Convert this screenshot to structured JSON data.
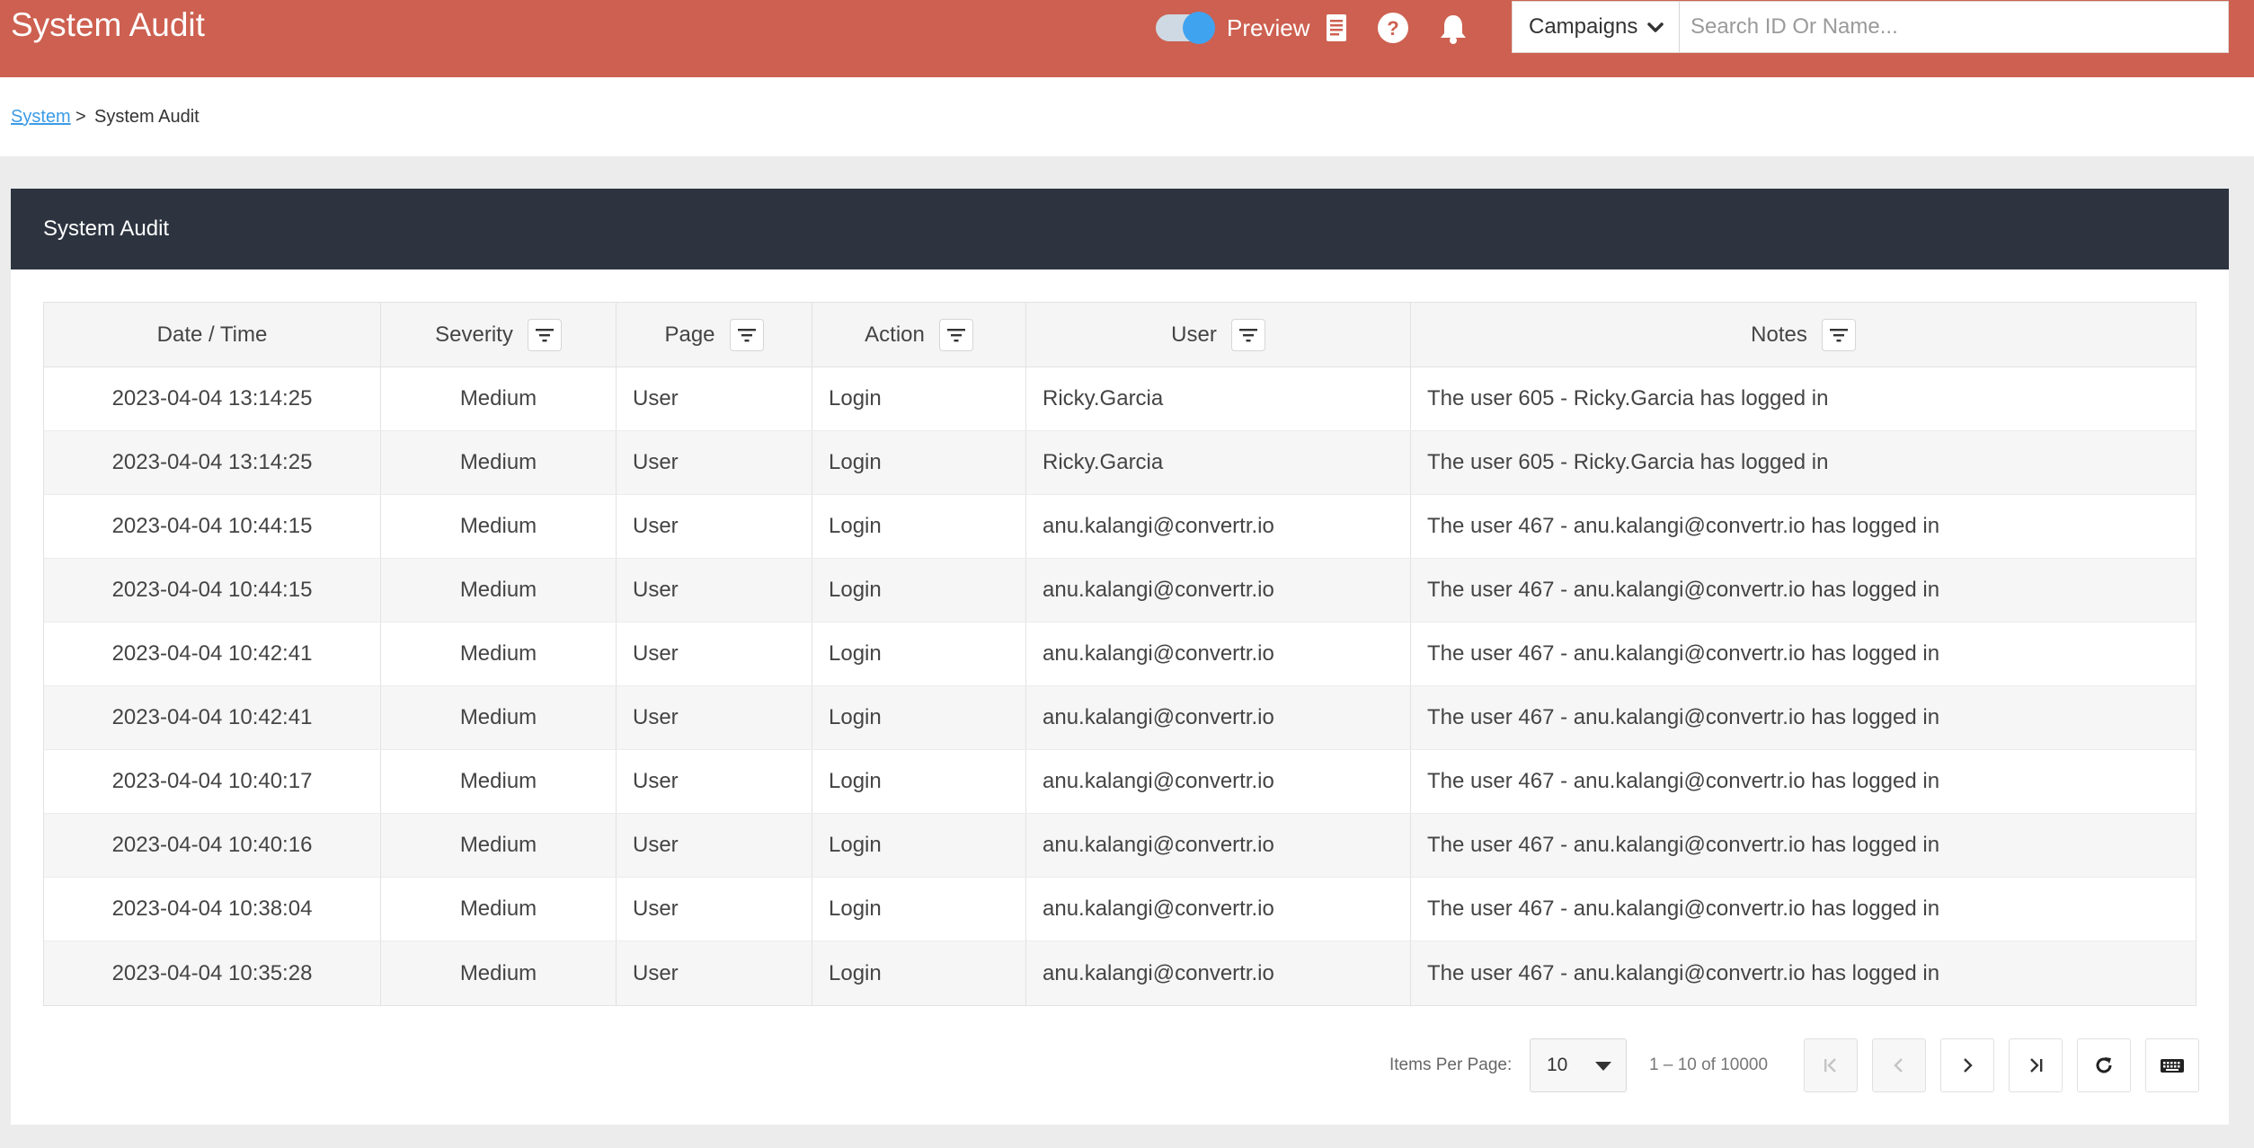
{
  "header": {
    "title": "System Audit",
    "preview_label": "Preview",
    "campaigns_label": "Campaigns",
    "search_placeholder": "Search ID Or Name..."
  },
  "breadcrumb": {
    "root": "System",
    "separator": ">",
    "current": "System Audit"
  },
  "card": {
    "title": "System Audit"
  },
  "table": {
    "columns": [
      "Date / Time",
      "Severity",
      "Page",
      "Action",
      "User",
      "Notes"
    ],
    "rows": [
      [
        "2023-04-04 13:14:25",
        "Medium",
        "User",
        "Login",
        "Ricky.Garcia",
        "The user 605 - Ricky.Garcia has logged in"
      ],
      [
        "2023-04-04 13:14:25",
        "Medium",
        "User",
        "Login",
        "Ricky.Garcia",
        "The user 605 - Ricky.Garcia has logged in"
      ],
      [
        "2023-04-04 10:44:15",
        "Medium",
        "User",
        "Login",
        "anu.kalangi@convertr.io",
        "The user 467 - anu.kalangi@convertr.io has logged in"
      ],
      [
        "2023-04-04 10:44:15",
        "Medium",
        "User",
        "Login",
        "anu.kalangi@convertr.io",
        "The user 467 - anu.kalangi@convertr.io has logged in"
      ],
      [
        "2023-04-04 10:42:41",
        "Medium",
        "User",
        "Login",
        "anu.kalangi@convertr.io",
        "The user 467 - anu.kalangi@convertr.io has logged in"
      ],
      [
        "2023-04-04 10:42:41",
        "Medium",
        "User",
        "Login",
        "anu.kalangi@convertr.io",
        "The user 467 - anu.kalangi@convertr.io has logged in"
      ],
      [
        "2023-04-04 10:40:17",
        "Medium",
        "User",
        "Login",
        "anu.kalangi@convertr.io",
        "The user 467 - anu.kalangi@convertr.io has logged in"
      ],
      [
        "2023-04-04 10:40:16",
        "Medium",
        "User",
        "Login",
        "anu.kalangi@convertr.io",
        "The user 467 - anu.kalangi@convertr.io has logged in"
      ],
      [
        "2023-04-04 10:38:04",
        "Medium",
        "User",
        "Login",
        "anu.kalangi@convertr.io",
        "The user 467 - anu.kalangi@convertr.io has logged in"
      ],
      [
        "2023-04-04 10:35:28",
        "Medium",
        "User",
        "Login",
        "anu.kalangi@convertr.io",
        "The user 467 - anu.kalangi@convertr.io has logged in"
      ]
    ]
  },
  "pagination": {
    "items_per_page_label": "Items Per Page:",
    "items_per_page_value": "10",
    "range": "1 – 10 of 10000"
  },
  "colors": {
    "header_bg": "#cd6050",
    "card_header_bg": "#2d3440",
    "toggle_knob": "#3fa3f0",
    "link": "#3b9be6"
  },
  "icons": {
    "header": [
      "document-icon",
      "help-icon",
      "bell-icon"
    ],
    "filter": "filter-icon",
    "pagination": [
      "first-page-icon",
      "previous-page-icon",
      "next-page-icon",
      "last-page-icon",
      "refresh-icon",
      "keyboard-icon"
    ]
  }
}
